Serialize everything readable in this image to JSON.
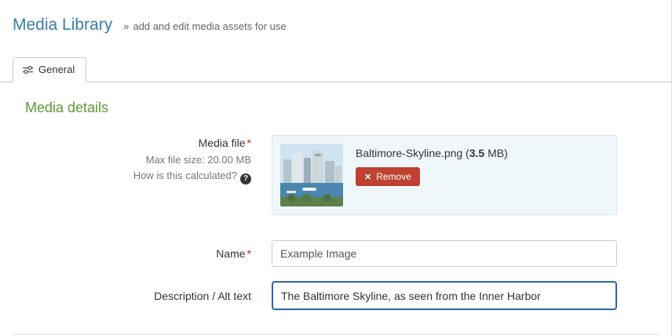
{
  "header": {
    "title": "Media Library",
    "sep": "»",
    "subtitle": "add and edit media assets for use"
  },
  "tabs": {
    "general": {
      "label": "General"
    }
  },
  "section": {
    "title": "Media details"
  },
  "form": {
    "media_file": {
      "label": "Media file",
      "required": "*",
      "max_size": "Max file size: 20.00 MB",
      "help_text": "How is this calculated?",
      "help_icon": "?",
      "file_prefix": "Baltimore-Skyline.png (",
      "file_size": "3.5",
      "file_suffix": " MB)",
      "remove": {
        "icon": "✕",
        "label": "Remove"
      }
    },
    "name": {
      "label": "Name",
      "required": "*",
      "value": "Example Image"
    },
    "description": {
      "label": "Description / Alt text",
      "value": "The Baltimore Skyline, as seen from the Inner Harbor"
    }
  },
  "colors": {
    "title_blue": "#3a7ca8",
    "heading_green": "#5f9638",
    "remove_red": "#bf4132",
    "focus_blue": "#2f63a7",
    "upload_bg": "#f0f7fb",
    "upload_border": "#d9e8f1"
  }
}
